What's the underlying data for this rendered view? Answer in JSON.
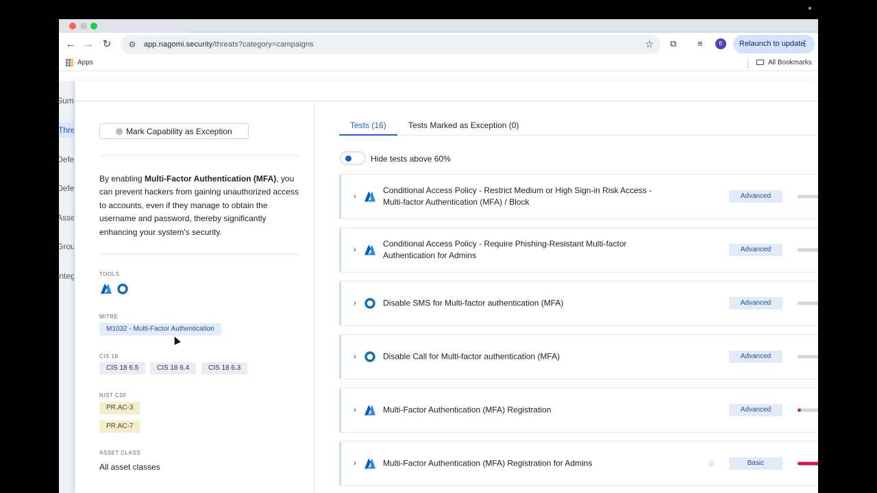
{
  "browser": {
    "url_host": "app.nagomi.security",
    "url_path": "/threats?category=campaigns",
    "relaunch_label": "Relaunch to update",
    "avatar_initial": "E",
    "bookmarks": {
      "apps": "Apps",
      "all": "All Bookmarks"
    }
  },
  "rail": {
    "items": [
      "Summ",
      "Threa",
      "Defe",
      "Defe",
      "Asse",
      "Grou",
      "Integ"
    ],
    "active_index": 1
  },
  "capability": {
    "exception_button": "Mark Capability as Exception",
    "description_pre": "By enabling ",
    "description_bold": "Multi-Factor Authentication (MFA)",
    "description_post": ", you can prevent hackers from gaining unauthorized access to accounts, even if they manage to obtain the username and password, thereby significantly enhancing your system's security.",
    "tools_label": "TOOLS",
    "tools": [
      "azure-icon",
      "okta-icon"
    ],
    "mitre_label": "MITRE",
    "mitre": [
      "M1032 - Multi-Factor Authentication"
    ],
    "cis_label": "CIS 18",
    "cis": [
      "CIS 18 6.5",
      "CIS 18 6.4",
      "CIS 18 6.3"
    ],
    "nist_label": "NIST CSF",
    "nist": [
      "PR.AC-3",
      "PR.AC-7"
    ],
    "asset_label": "ASSET CLASS",
    "asset_value": "All asset classes"
  },
  "tabs": {
    "tests": "Tests (16)",
    "exceptions": "Tests Marked as Exception (0)"
  },
  "toggle_label": "Hide tests above 60%",
  "tests": [
    {
      "tool": "azure",
      "title": "Conditional Access Policy - Restrict Medium or High Sign-in Risk Access - Multi-factor Authentication (MFA) / Block",
      "level": "Advanced",
      "progress": 0
    },
    {
      "tool": "azure",
      "title": "Conditional Access Policy - Require Phishing-Resistant Multi-factor Authentication for Admins",
      "level": "Advanced",
      "progress": 0
    },
    {
      "tool": "okta",
      "title": "Disable SMS for Multi-factor authentication (MFA)",
      "level": "Advanced",
      "progress": 0
    },
    {
      "tool": "okta",
      "title": "Disable Call for Multi-factor authentication (MFA)",
      "level": "Advanced",
      "progress": 0
    },
    {
      "tool": "azure",
      "title": "Multi-Factor Authentication (MFA) Registration",
      "level": "Advanced",
      "progress": 8
    },
    {
      "tool": "azure",
      "title": "Multi-Factor Authentication (MFA) Registration for Admins",
      "level": "Basic",
      "progress": 100,
      "hidden_eye": true
    }
  ],
  "colors": {
    "accent": "#1a5fd0",
    "badge_bg": "#e2ebf8",
    "progress_fill": "#d0175a"
  }
}
